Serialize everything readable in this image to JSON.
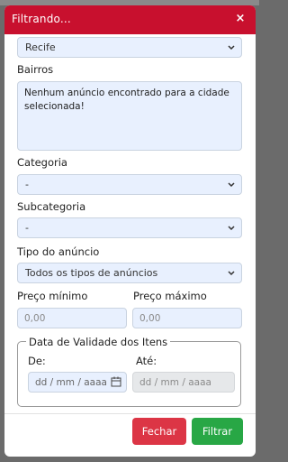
{
  "modal": {
    "title": "Filtrando...",
    "close_glyph": "×"
  },
  "city_select": {
    "value": "Recife"
  },
  "bairros": {
    "label": "Bairros",
    "message": "Nenhum anúncio encontrado para a cidade selecionada!"
  },
  "categoria": {
    "label": "Categoria",
    "value": "-"
  },
  "subcategoria": {
    "label": "Subcategoria",
    "value": "-"
  },
  "tipo": {
    "label": "Tipo do anúncio",
    "value": "Todos os tipos de anúncios"
  },
  "preco": {
    "min_label": "Preço mínimo",
    "max_label": "Preço máximo",
    "min_placeholder": "0,00",
    "max_placeholder": "0,00"
  },
  "validade": {
    "legend": "Data de Validade dos Itens",
    "from_label": "De:",
    "to_label": "Até:",
    "date_placeholder": "dd / mm / aaaa"
  },
  "footer": {
    "close_label": "Fechar",
    "filter_label": "Filtrar"
  },
  "colors": {
    "header": "#c8102e",
    "field_bg": "#e8f0fe",
    "close_button": "#dc3545",
    "filter_button": "#28a745"
  },
  "icons": [
    "close-icon",
    "chevron-down-icon",
    "calendar-icon"
  ]
}
